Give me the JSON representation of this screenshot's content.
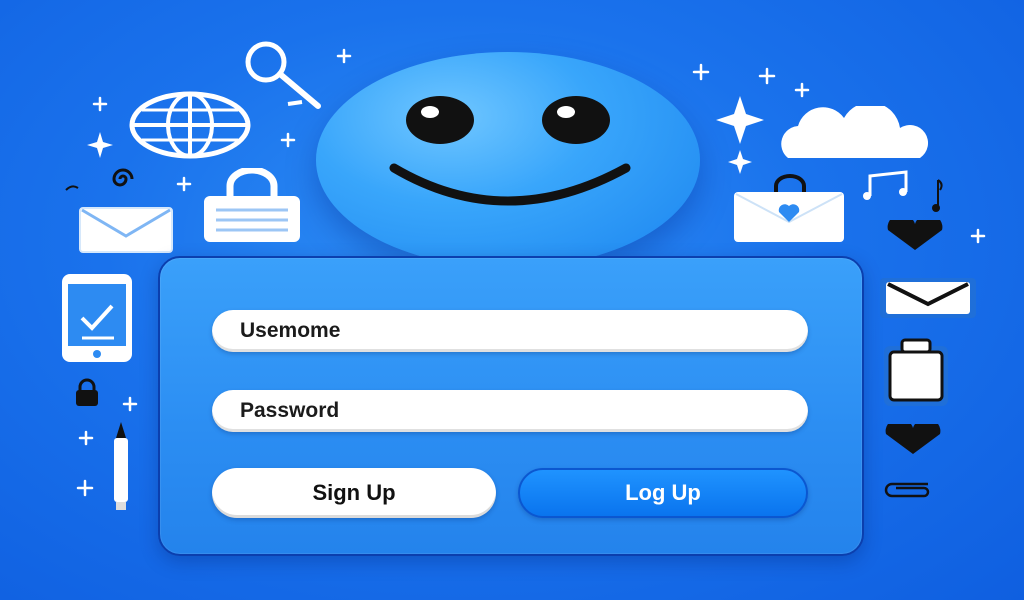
{
  "form": {
    "username_placeholder": "Usemome",
    "password_placeholder": "Password",
    "signup_label": "Sign Up",
    "login_label": "Log Up"
  },
  "colors": {
    "background": "#1a72ec",
    "panel": "#2b8df2",
    "panel_border": "#0b3fae",
    "login_button": "#0a74ee",
    "field": "#ffffff"
  },
  "icons": [
    "search-icon",
    "globe-icon",
    "spiral-icon",
    "lock-icon",
    "mail-icon",
    "smartphone-checkmark-icon",
    "padlock-icon",
    "pen-icon",
    "cloud-icon",
    "heart-mail-icon",
    "music-note-icon",
    "heart-icon",
    "clipboard-icon",
    "paperclip-icon",
    "sparkle-icon"
  ]
}
